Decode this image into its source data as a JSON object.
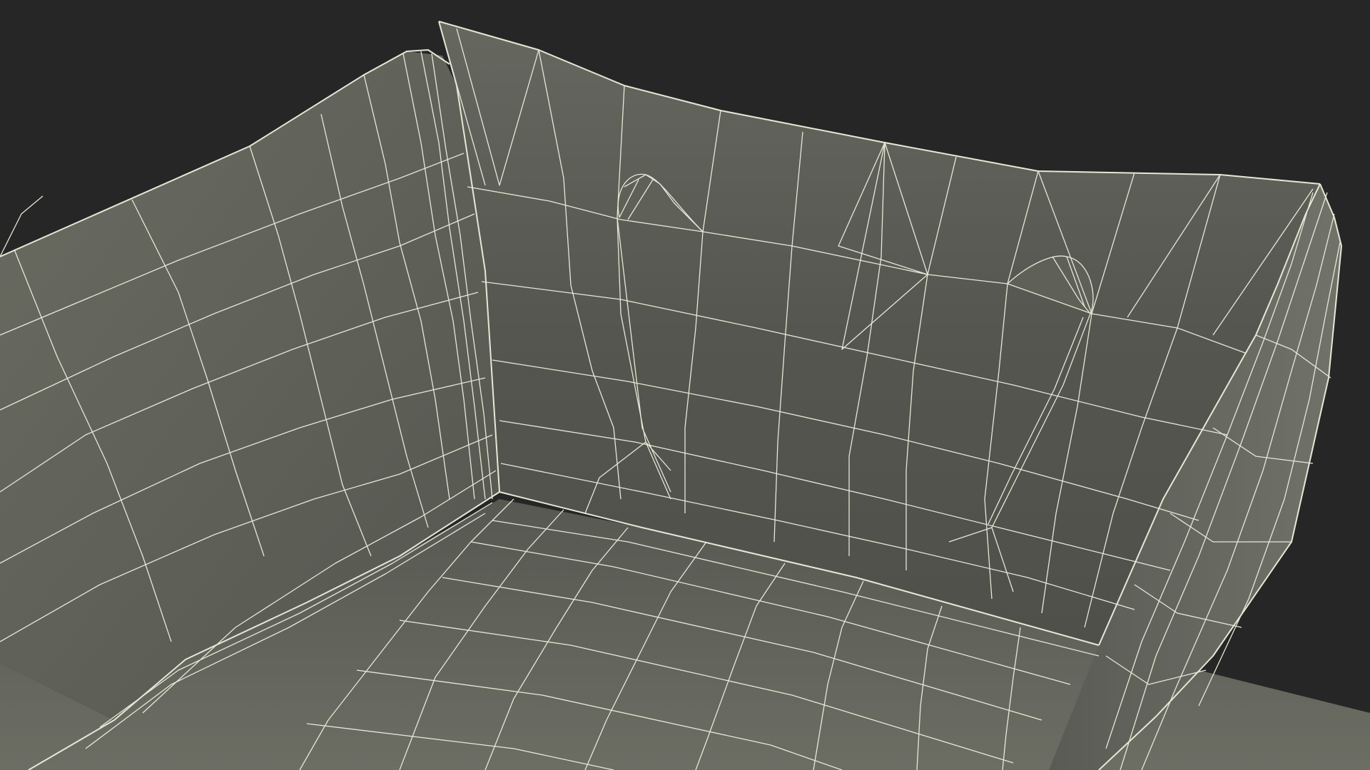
{
  "scene": {
    "subject": "wireframe-mesh-tray",
    "colors": {
      "background": "#262626",
      "surface_light": "#686a60",
      "surface_mid": "#5b5c54",
      "surface_dark": "#4c4d47",
      "wire": "#e6e8d6"
    }
  }
}
